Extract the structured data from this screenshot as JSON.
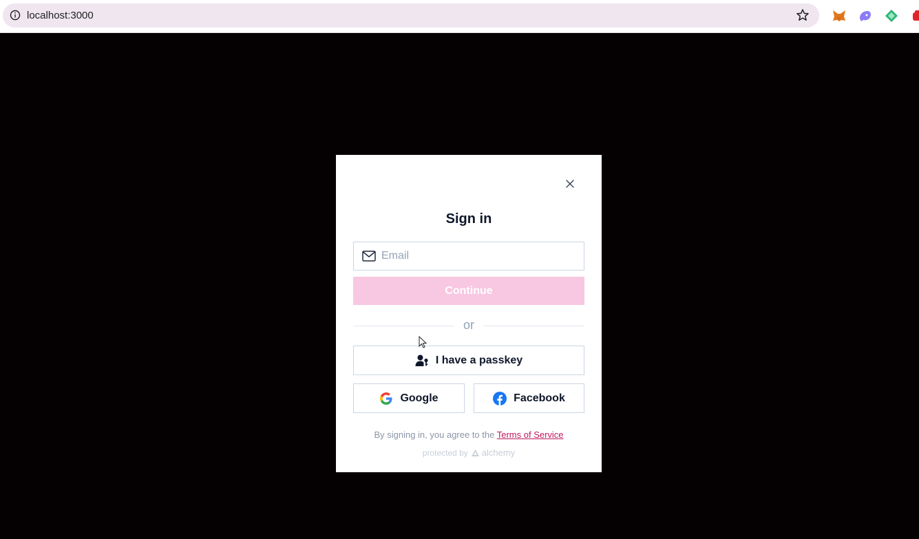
{
  "browser": {
    "url": "localhost:3000",
    "extensions": [
      "metamask-fox-icon",
      "purple-wallet-icon",
      "green-diamond-icon",
      "red-extension-icon"
    ]
  },
  "modal": {
    "title": "Sign in",
    "email": {
      "value": "",
      "placeholder": "Email"
    },
    "continue_label": "Continue",
    "divider_text": "or",
    "passkey_label": "I have a passkey",
    "google_label": "Google",
    "facebook_label": "Facebook",
    "terms_prefix": "By signing in, you agree to the ",
    "terms_link": "Terms of Service",
    "protected_by": "protected by",
    "brand_name": "alchemy"
  },
  "colors": {
    "accent_disabled": "#f8c7e2",
    "link": "#be185d",
    "background": "#050001"
  }
}
